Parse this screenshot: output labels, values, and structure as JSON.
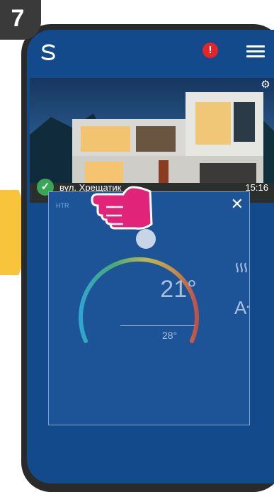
{
  "step": {
    "number": "7"
  },
  "topbar": {
    "alert_label": "!"
  },
  "house": {
    "name": "вул. Хрещатик",
    "time": "15:16"
  },
  "thermostat": {
    "mode_label": "HTR",
    "close_label": "✕",
    "current_temp": "21°",
    "set_temp": "28°",
    "auto_label": "A"
  },
  "icons": {
    "logo": "salus-logo-icon",
    "alert": "alert-icon",
    "menu": "hamburger-menu-icon",
    "gear": "gear-icon",
    "check": "check-circle-icon",
    "heat": "heat-waves-icon",
    "auto": "auto-mode-icon",
    "hand": "pointing-hand-icon"
  },
  "colors": {
    "screen_bg": "#124a8c",
    "tile_bg": "#1d5497",
    "accent_arrow": "#f8c43c",
    "alert_red": "#e52528",
    "check_green": "#3aa556"
  }
}
